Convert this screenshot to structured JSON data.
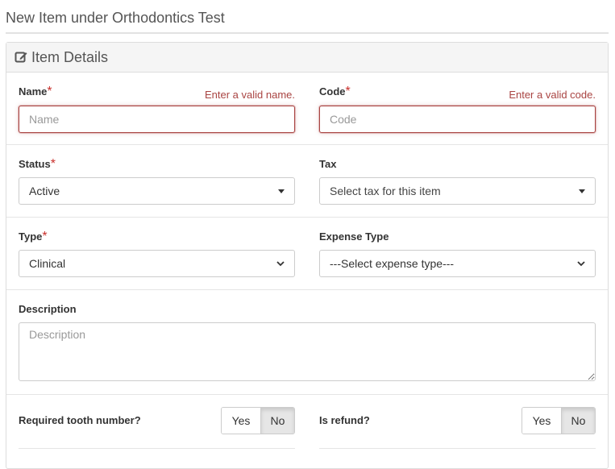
{
  "page": {
    "title": "New Item under Orthodontics Test"
  },
  "panel": {
    "heading": "Item Details",
    "heading_icon": "edit-icon"
  },
  "form": {
    "name": {
      "label": "Name",
      "required_mark": "*",
      "error": "Enter a valid name.",
      "placeholder": "Name",
      "value": ""
    },
    "code": {
      "label": "Code",
      "required_mark": "*",
      "error": "Enter a valid code.",
      "placeholder": "Code",
      "value": ""
    },
    "status": {
      "label": "Status",
      "required_mark": "*",
      "selected": "Active"
    },
    "tax": {
      "label": "Tax",
      "placeholder": "Select tax for this item"
    },
    "type": {
      "label": "Type",
      "required_mark": "*",
      "selected": "Clinical"
    },
    "expense_type": {
      "label": "Expense Type",
      "selected": "---Select expense type---"
    },
    "description": {
      "label": "Description",
      "placeholder": "Description",
      "value": ""
    },
    "tooth_number": {
      "label": "Required tooth number?",
      "yes_label": "Yes",
      "no_label": "No",
      "selected": "No"
    },
    "refund": {
      "label": "Is refund?",
      "yes_label": "Yes",
      "no_label": "No",
      "selected": "No"
    }
  },
  "colors": {
    "error": "#a94442",
    "required": "#c9302c",
    "panel_heading_bg": "#f5f5f5",
    "active_toggle_bg": "#e6e6e6"
  }
}
